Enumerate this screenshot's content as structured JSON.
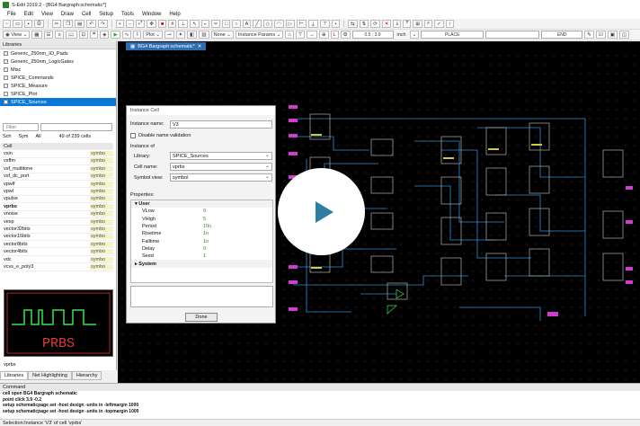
{
  "window": {
    "title": "S-Edit 2019.2 - [BG4 Bargraph:schematic*]"
  },
  "menu": [
    "File",
    "Edit",
    "View",
    "Draw",
    "Cell",
    "Setup",
    "Tools",
    "Window",
    "Help"
  ],
  "toolbar": {
    "view_label": "View",
    "plot_label": "Plot",
    "none_label": "None",
    "instance_params_label": "Instance Params",
    "coord_value": "0.5 ; 3.9",
    "units_value": "inch",
    "place_label": "PLACE",
    "end_label": "END"
  },
  "libraries": {
    "header": "Libraries",
    "items": [
      "Generic_250nm_IO_Pads",
      "Generic_250nm_LogicGates",
      "Misc",
      "SPICE_Commands",
      "SPICE_Measure",
      "SPICE_Plot",
      "SPICE_Sources"
    ],
    "selected_index": 6
  },
  "cells": {
    "filter_placeholder": "Filter",
    "tabs": [
      "Sch",
      "Sym",
      "All"
    ],
    "count": "49 of 239 cells",
    "header": "Cell",
    "items": [
      {
        "name": "vsin",
        "view": "symbo"
      },
      {
        "name": "vsffm",
        "view": "symbo"
      },
      {
        "name": "vsf_multitone",
        "view": "symbo"
      },
      {
        "name": "vsf_dc_port",
        "view": "symbo"
      },
      {
        "name": "vpwlf",
        "view": "symbo"
      },
      {
        "name": "vpwl",
        "view": "symbo"
      },
      {
        "name": "vpulse",
        "view": "symbo"
      },
      {
        "name": "vprbs",
        "view": "symbo"
      },
      {
        "name": "vnoise",
        "view": "symbo"
      },
      {
        "name": "vexp",
        "view": "symbo"
      },
      {
        "name": "vector32bits",
        "view": "symbo"
      },
      {
        "name": "vector16bits",
        "view": "symbo"
      },
      {
        "name": "vector8bits",
        "view": "symbo"
      },
      {
        "name": "vector4bits",
        "view": "symbo"
      },
      {
        "name": "vdc",
        "view": "symbo"
      },
      {
        "name": "vcvs_e_poly3",
        "view": "symbo"
      }
    ],
    "selected_index": 7
  },
  "preview": {
    "text": "PRBS",
    "caption": "vprbs"
  },
  "panel_tabs": [
    "Libraries",
    "Net Highlighting",
    "Hierarchy"
  ],
  "document_tab": "BG4 Bargraph:schematic*",
  "dialog": {
    "title": "Instance Cell",
    "instance_name_label": "Instance name:",
    "instance_name": "V3",
    "disable_validation_label": "Disable name validation",
    "instance_of_label": "Instance of",
    "library_label": "Library:",
    "library_value": "SPICE_Sources",
    "cell_label": "Cell name:",
    "cell_value": "vprbs",
    "symbol_label": "Symbol view:",
    "symbol_value": "symbol",
    "properties_label": "Properties:",
    "user_group": "User",
    "system_group": "System",
    "properties": [
      {
        "name": "VLow",
        "value": "0"
      },
      {
        "name": "VHigh",
        "value": "5"
      },
      {
        "name": "Period",
        "value": "10n"
      },
      {
        "name": "Risetime",
        "value": "1n"
      },
      {
        "name": "Falltime",
        "value": "1n"
      },
      {
        "name": "Delay",
        "value": "0"
      },
      {
        "name": "Seed",
        "value": "1"
      }
    ],
    "done_label": "Done"
  },
  "command": {
    "header": "Command",
    "lines": [
      "cell open BG4 Bargraph schematic",
      "point click 3.9 -0.2",
      "setup schematicpage set -host design -units in -leftmargin 1000",
      "setup schematicpage set -host design -units in -topmargin 1000"
    ]
  },
  "status": "Selection:Instance 'V3' of cell 'vprbs'"
}
